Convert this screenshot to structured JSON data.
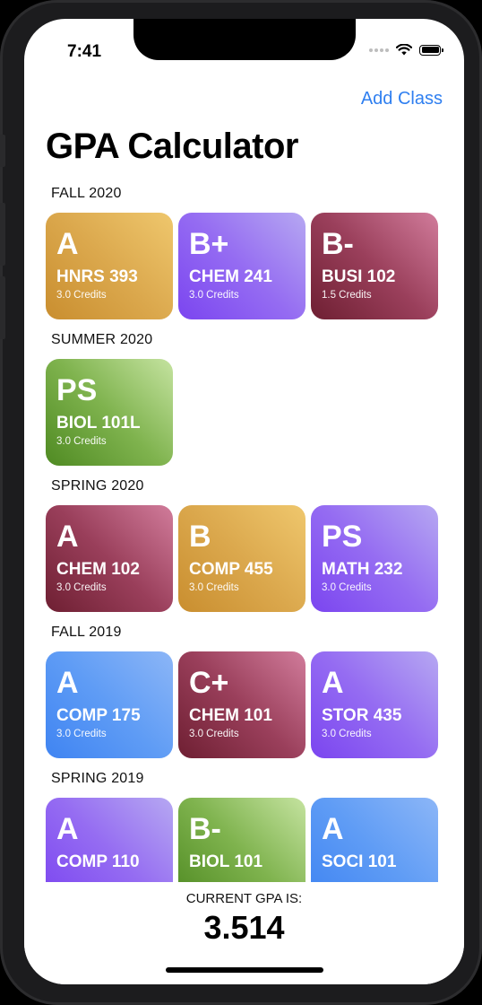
{
  "status_bar": {
    "time": "7:41"
  },
  "nav": {
    "add_class_label": "Add Class",
    "title": "GPA Calculator"
  },
  "terms": [
    {
      "label": "FALL 2020",
      "classes": [
        {
          "grade": "A",
          "course": "HNRS 393",
          "credits": "3.0 Credits",
          "color": "gold"
        },
        {
          "grade": "B+",
          "course": "CHEM 241",
          "credits": "3.0 Credits",
          "color": "purple"
        },
        {
          "grade": "B-",
          "course": "BUSI 102",
          "credits": "1.5 Credits",
          "color": "maroon"
        }
      ]
    },
    {
      "label": "SUMMER 2020",
      "classes": [
        {
          "grade": "PS",
          "course": "BIOL 101L",
          "credits": "3.0 Credits",
          "color": "green"
        }
      ]
    },
    {
      "label": "SPRING 2020",
      "classes": [
        {
          "grade": "A",
          "course": "CHEM 102",
          "credits": "3.0 Credits",
          "color": "maroon"
        },
        {
          "grade": "B",
          "course": "COMP 455",
          "credits": "3.0 Credits",
          "color": "gold"
        },
        {
          "grade": "PS",
          "course": "MATH 232",
          "credits": "3.0 Credits",
          "color": "purple"
        }
      ]
    },
    {
      "label": "FALL 2019",
      "classes": [
        {
          "grade": "A",
          "course": "COMP 175",
          "credits": "3.0 Credits",
          "color": "blue"
        },
        {
          "grade": "C+",
          "course": "CHEM 101",
          "credits": "3.0 Credits",
          "color": "maroon"
        },
        {
          "grade": "A",
          "course": "STOR 435",
          "credits": "3.0 Credits",
          "color": "purple"
        }
      ]
    },
    {
      "label": "SPRING 2019",
      "classes": [
        {
          "grade": "A",
          "course": "COMP 110",
          "credits": "",
          "color": "purple"
        },
        {
          "grade": "B-",
          "course": "BIOL 101",
          "credits": "",
          "color": "green"
        },
        {
          "grade": "A",
          "course": "SOCI 101",
          "credits": "",
          "color": "blue"
        }
      ]
    }
  ],
  "footer": {
    "gpa_label": "CURRENT GPA IS:",
    "gpa_value": "3.514"
  },
  "colors": {
    "accent": "#2f7ff0",
    "gold": "#dba84d",
    "purple": "#956cf2",
    "maroon": "#9a3f5b",
    "green": "#7fb34e",
    "blue": "#5f9cf5"
  }
}
